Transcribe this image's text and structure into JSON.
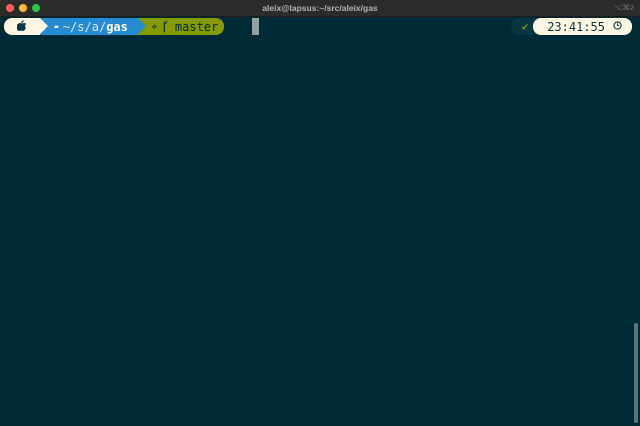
{
  "window": {
    "title": "aleix@lapsus:~/src/aleix/gas",
    "shortcut": "⌥⌘2"
  },
  "prompt": {
    "os_icon": "apple-icon",
    "directory_prefix": "~/s/a/",
    "directory_current": "gas",
    "git_icon": "git-icon",
    "branch_icon": "branch-icon",
    "branch": "master"
  },
  "right_prompt": {
    "status_icon": "checkmark-icon",
    "status_glyph": "✔",
    "time": "23:41:55",
    "clock_icon": "clock-icon"
  },
  "colors": {
    "background": "#002b36",
    "dir_segment": "#268bd2",
    "git_segment": "#859900",
    "light_segment": "#fdf6e3"
  }
}
